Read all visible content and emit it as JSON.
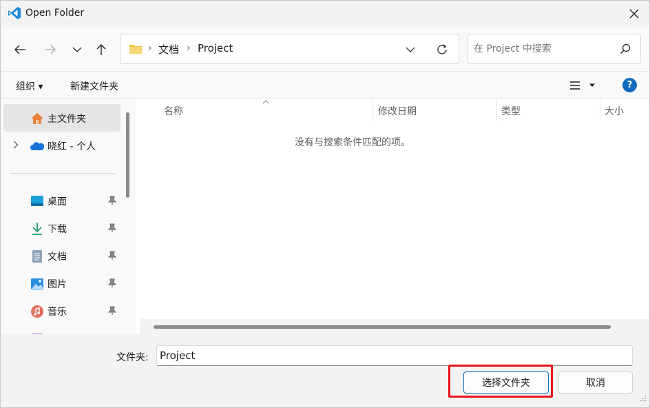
{
  "window": {
    "title": "Open Folder"
  },
  "address": {
    "crumbs": [
      "文档",
      "Project"
    ],
    "separator": "›"
  },
  "search": {
    "placeholder": "在 Project 中搜索"
  },
  "commands": {
    "organize": "组织 ▾",
    "new_folder": "新建文件夹",
    "help": "?"
  },
  "sidebar": {
    "items": [
      {
        "label": "主文件夹",
        "icon": "home-icon",
        "pinned": false,
        "selected": true
      },
      {
        "label": "晓红 - 个人",
        "icon": "onedrive-cloud-icon",
        "pinned": false,
        "expandable": true
      },
      {
        "label": "桌面",
        "icon": "desktop-icon",
        "pinned": true
      },
      {
        "label": "下载",
        "icon": "download-icon",
        "pinned": true
      },
      {
        "label": "文档",
        "icon": "documents-icon",
        "pinned": true
      },
      {
        "label": "图片",
        "icon": "pictures-icon",
        "pinned": true
      },
      {
        "label": "音乐",
        "icon": "music-icon",
        "pinned": true
      }
    ]
  },
  "list": {
    "columns": [
      "名称",
      "修改日期",
      "类型",
      "大小"
    ],
    "empty_message": "没有与搜索条件匹配的项。"
  },
  "footer": {
    "folder_label": "文件夹:",
    "folder_value": "Project",
    "select_button": "选择文件夹",
    "cancel_button": "取消"
  },
  "colors": {
    "accent": "#0f6cbd",
    "highlight": "#e8141a",
    "folder": "#f3c13a"
  }
}
